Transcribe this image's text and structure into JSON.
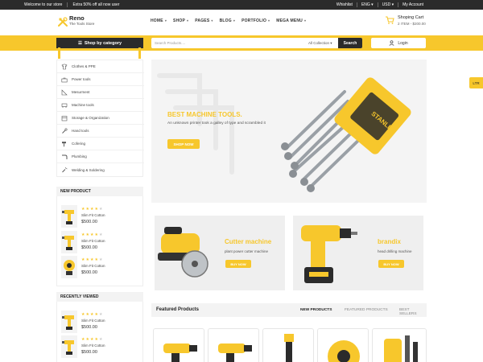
{
  "topbar": {
    "welcome": "Welcome to our store",
    "promo": "Extra 50% off all now user",
    "wishlist": "Whishlist",
    "language": "ENG ▾",
    "currency": "USD ▾",
    "account": "My Account"
  },
  "header": {
    "logo_name": "Reno",
    "logo_sub": "The Tools Store",
    "nav": [
      "HOME",
      "SHOP",
      "PAGES",
      "BLOG",
      "PORTFOLIO",
      "MEGA MENU"
    ],
    "cart_title": "Shoping Cart",
    "cart_sub": "2 ITEM - $200.00"
  },
  "search": {
    "category_button": "Shop by category",
    "placeholder": "Search Products....",
    "collection": "All Collection ▾",
    "button": "Search",
    "login": "Login"
  },
  "categories": [
    {
      "label": "Clothes & PPE",
      "icon": "shirt-icon"
    },
    {
      "label": "Power tools",
      "icon": "toolbox-icon"
    },
    {
      "label": "Mesurment",
      "icon": "ruler-icon"
    },
    {
      "label": "Machine tools",
      "icon": "machine-icon"
    },
    {
      "label": "Storage & Organization",
      "icon": "box-icon"
    },
    {
      "label": "Hand tools",
      "icon": "hand-tool-icon"
    },
    {
      "label": "Cofering",
      "icon": "hammer-icon"
    },
    {
      "label": "Plumbing",
      "icon": "pipe-icon"
    },
    {
      "label": "Welding & Soldering",
      "icon": "welding-icon"
    }
  ],
  "new_product": {
    "title": "NEW PRODUCT",
    "items": [
      {
        "name": "Slim Fit Cotton",
        "price": "$500.00",
        "rating": 4
      },
      {
        "name": "Slim Fit Cotton",
        "price": "$500.00",
        "rating": 4
      },
      {
        "name": "Slim Fit Cotton",
        "price": "$500.00",
        "rating": 4
      }
    ]
  },
  "recently_viewed": {
    "title": "RECENTLY VIEWED",
    "items": [
      {
        "name": "Slim Fit Cotton",
        "price": "$500.00",
        "rating": 4
      },
      {
        "name": "Slim Fit Cotton",
        "price": "$500.00",
        "rating": 4
      }
    ]
  },
  "hero": {
    "title": "BEST MACHINE TOOLS.",
    "description": "An unknown printer took a galley of type and scrambled it",
    "button": "SHOP NOW",
    "brand_text": "STANLEY"
  },
  "promos": [
    {
      "title": "Cutter machine",
      "description": "plant power cutter machine",
      "button": "BUY NOW"
    },
    {
      "title": "brandix",
      "description": "head drilling machine",
      "button": "BUY NOW"
    }
  ],
  "featured": {
    "title": "Featured Products",
    "tabs": [
      "NEW PRODUCTS",
      "FEATURED PRODUCTS",
      "BEST SELLERS"
    ]
  },
  "ltr": "LTR",
  "colors": {
    "accent": "#f7c72c",
    "dark": "#2b2b2b"
  }
}
